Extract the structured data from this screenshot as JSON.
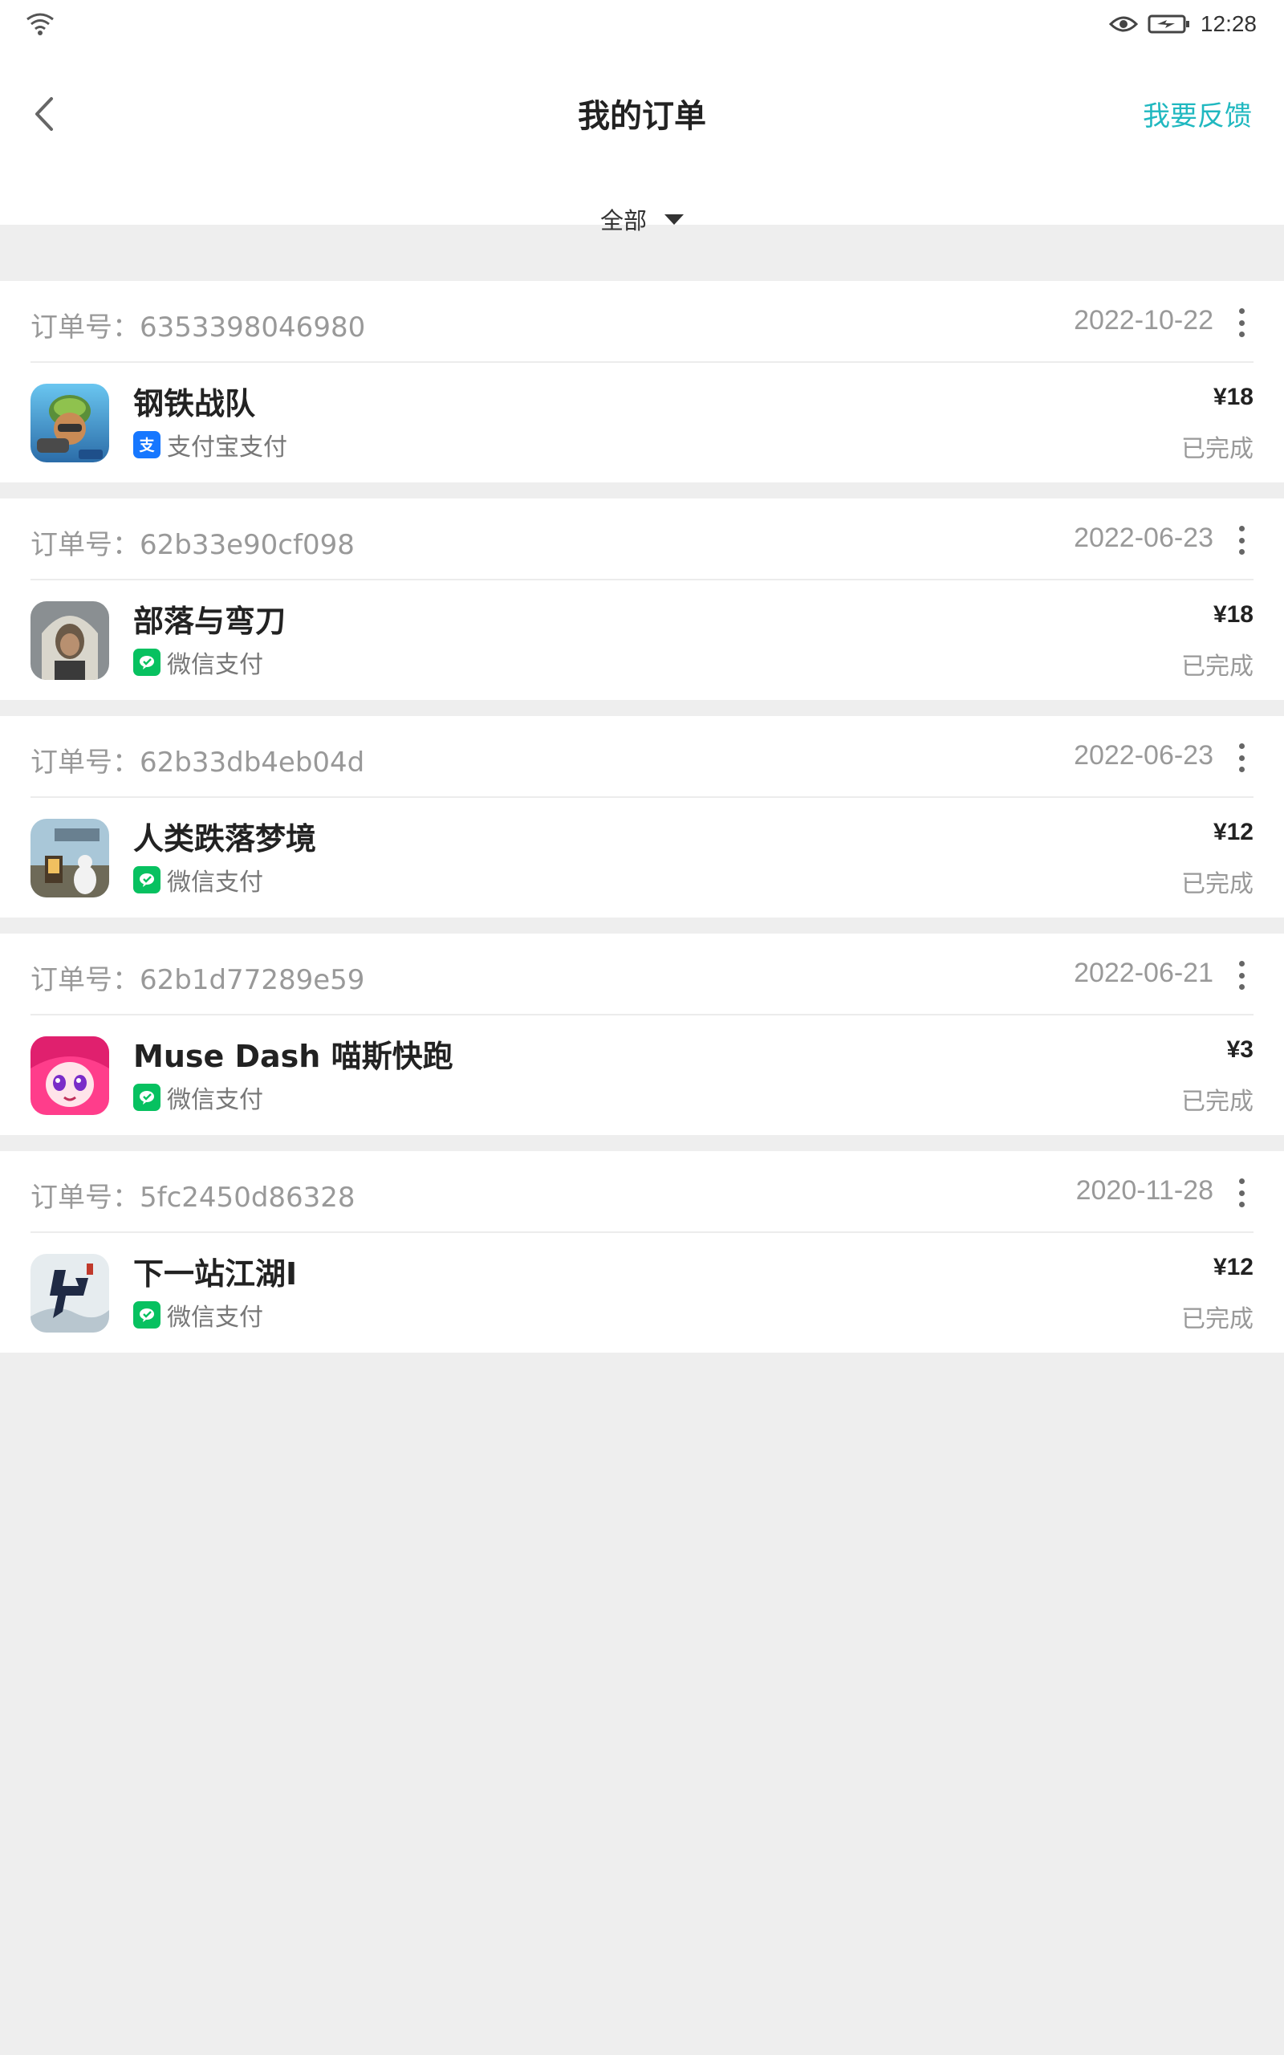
{
  "status_bar": {
    "time": "12:28",
    "icons": [
      "wifi-icon",
      "eye-icon",
      "battery-charging-icon"
    ]
  },
  "header": {
    "title": "我的订单",
    "feedback_label": "我要反馈",
    "back_icon": "chevron-left-icon",
    "accent_color": "#20b8c0"
  },
  "filter": {
    "selected": "全部"
  },
  "orders": [
    {
      "order_no_label": "订单号：6353398046980",
      "date": "2022-10-22",
      "game_name": "钢铁战队",
      "icon": "game-icon-steel-squad",
      "pay_method": "支付宝支付",
      "pay_type": "alipay",
      "price": "¥18",
      "status": "已完成"
    },
    {
      "order_no_label": "订单号：62b33e90cf098",
      "date": "2022-06-23",
      "game_name": "部落与弯刀",
      "icon": "game-icon-tribe-and-blade",
      "pay_method": "微信支付",
      "pay_type": "wechat",
      "price": "¥18",
      "status": "已完成"
    },
    {
      "order_no_label": "订单号：62b33db4eb04d",
      "date": "2022-06-23",
      "game_name": "人类跌落梦境",
      "icon": "game-icon-human-fall-flat",
      "pay_method": "微信支付",
      "pay_type": "wechat",
      "price": "¥12",
      "status": "已完成"
    },
    {
      "order_no_label": "订单号：62b1d77289e59",
      "date": "2022-06-21",
      "game_name": "Muse Dash 喵斯快跑",
      "icon": "game-icon-muse-dash",
      "pay_method": "微信支付",
      "pay_type": "wechat",
      "price": "¥3",
      "status": "已完成"
    },
    {
      "order_no_label": "订单号：5fc2450d86328",
      "date": "2020-11-28",
      "game_name": "下一站江湖Ⅰ",
      "icon": "game-icon-next-stop-jianghu",
      "pay_method": "微信支付",
      "pay_type": "wechat",
      "price": "¥12",
      "status": "已完成"
    }
  ],
  "colors": {
    "alipay": "#1677ff",
    "wechat": "#07c160",
    "background": "#eeeeee"
  }
}
